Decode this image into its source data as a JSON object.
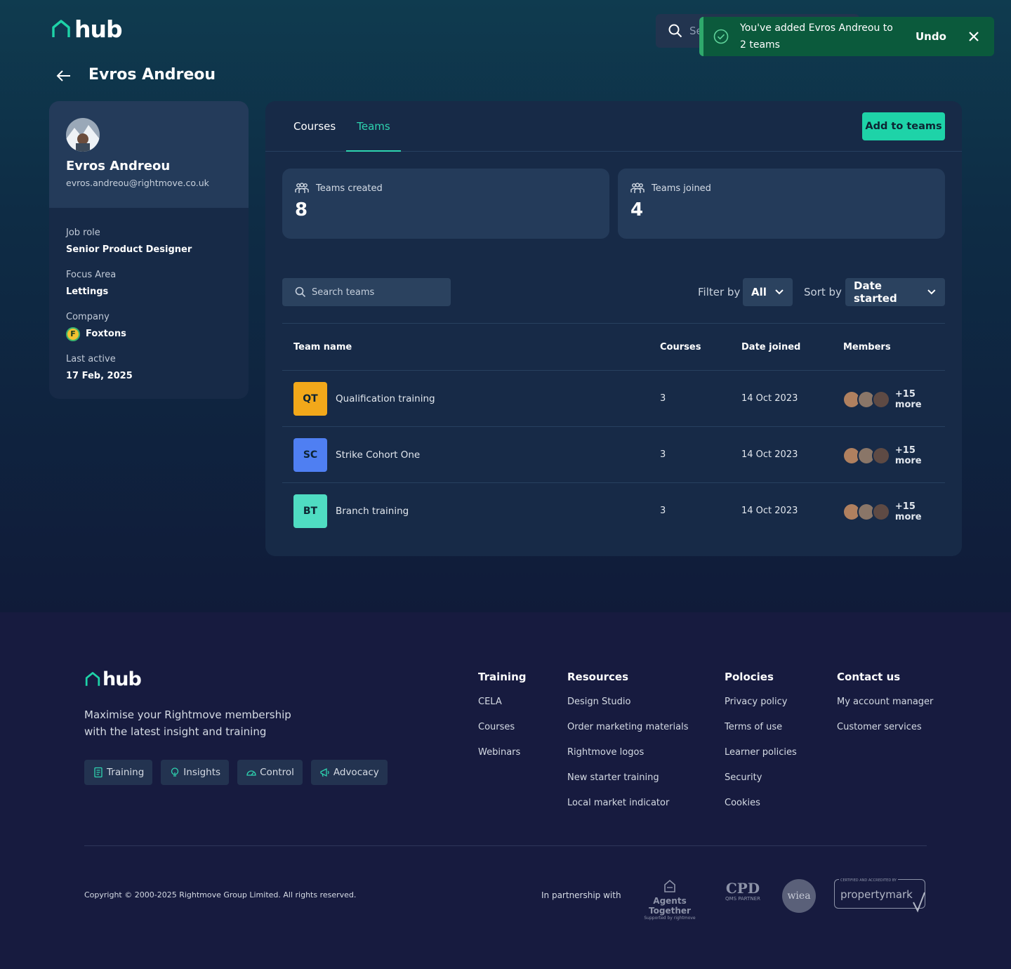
{
  "app": {
    "name": "hub"
  },
  "header": {
    "search_placeholder": "Se"
  },
  "toast": {
    "message": "You've added Evros Andreou to 2 teams",
    "undo_label": "Undo"
  },
  "page": {
    "title": "Evros Andreou"
  },
  "profile": {
    "name": "Evros Andreou",
    "email": "evros.andreou@rightmove.co.uk",
    "fields": [
      {
        "label": "Job role",
        "value": "Senior Product Designer"
      },
      {
        "label": "Focus Area",
        "value": "Lettings"
      },
      {
        "label": "Company",
        "value": "Foxtons",
        "icon_letter": "F"
      },
      {
        "label": "Last active",
        "value": "17 Feb, 2025"
      }
    ]
  },
  "tabs": [
    {
      "label": "Courses"
    },
    {
      "label": "Teams",
      "active": true
    }
  ],
  "add_button": "Add to teams",
  "stats": [
    {
      "label": "Teams created",
      "value": "8",
      "icon": "team-icon"
    },
    {
      "label": "Teams joined",
      "value": "4",
      "icon": "team-icon"
    }
  ],
  "search": {
    "placeholder": "Search teams"
  },
  "filter": {
    "label": "Filter by",
    "value": "All"
  },
  "sort": {
    "label": "Sort by",
    "value": "Date started"
  },
  "table": {
    "headers": [
      "Team name",
      "Courses",
      "Date joined",
      "Members"
    ],
    "rows": [
      {
        "initials": "QT",
        "name": "Qualification training",
        "courses": "3",
        "date": "14 Oct 2023",
        "more": "+15 more",
        "color": "#f2a81a"
      },
      {
        "initials": "SC",
        "name": "Strike Cohort One",
        "courses": "3",
        "date": "14 Oct 2023",
        "more": "+15 more",
        "color": "#4f7ff2"
      },
      {
        "initials": "BT",
        "name": "Branch training",
        "courses": "3",
        "date": "14 Oct 2023",
        "more": "+15 more",
        "color": "#4fdcc2"
      }
    ]
  },
  "footer": {
    "logo": "hub",
    "tagline": "Maximise your Rightmove membership with the latest insight and training",
    "chips": [
      "Training",
      "Insights",
      "Control",
      "Advocacy"
    ],
    "columns": [
      {
        "title": "Training",
        "links": [
          "CELA",
          "Courses",
          "Webinars"
        ]
      },
      {
        "title": "Resources",
        "links": [
          "Design Studio",
          "Order marketing materials",
          "Rightmove logos",
          "New starter training",
          "Local market indicator"
        ]
      },
      {
        "title": "Polocies",
        "links": [
          "Privacy policy",
          "Terms of use",
          "Learner policies",
          "Security",
          "Cookies"
        ]
      },
      {
        "title": "Contact us",
        "links": [
          "My account manager",
          "Customer services"
        ]
      }
    ],
    "copyright": "Copyright © 2000-2025 Rightmove Group Limited. All rights reserved.",
    "partnership": "In partnership with",
    "partners": {
      "agents_together": "Agents Together",
      "agents_sub": "Supported by rightmove",
      "cpd": "CPD",
      "cpd_sub": "QMS PARTNER",
      "wiea": "wiea",
      "propertymark": "propertymark",
      "propertymark_sub": "CERTIFIED AND ACCREDITED BY"
    }
  },
  "colors": {
    "accent": "#1ed3a8",
    "toast_bg": "#0b5a3c",
    "panel": "#172a47",
    "card": "#243b5a"
  }
}
